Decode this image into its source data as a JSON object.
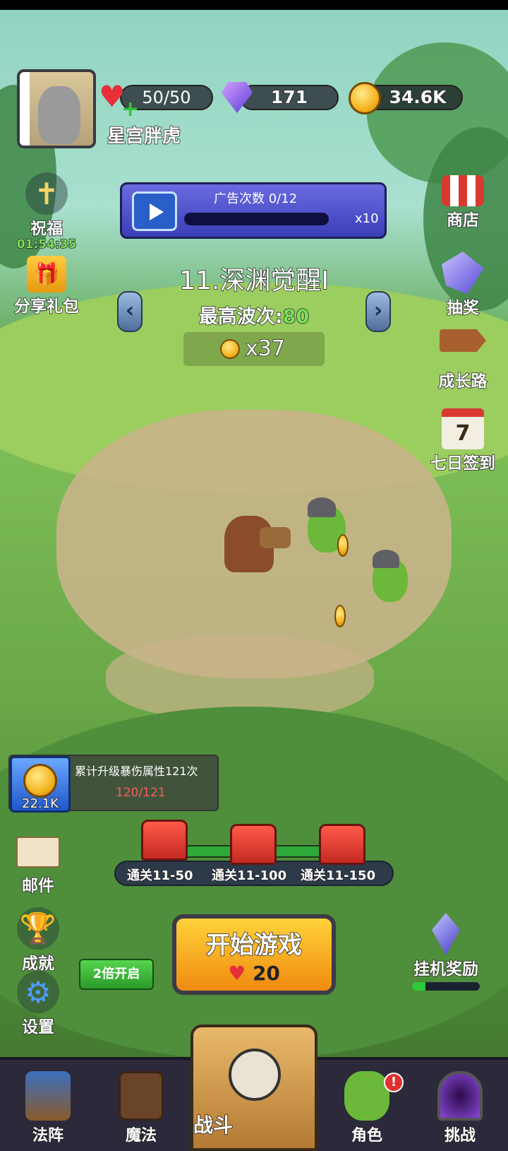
{
  "player": {
    "name": "星宫胖虎"
  },
  "resources": {
    "energy": "50/50",
    "gems": "171",
    "coins": "34.6K"
  },
  "ad": {
    "title": "广告次数 0/12",
    "progress": 0,
    "multiplier": "x10"
  },
  "left_menu": [
    {
      "label": "祝福",
      "timer": "01:54:35",
      "icon": "cross-icon"
    },
    {
      "label": "分享礼包",
      "icon": "gift-icon"
    }
  ],
  "right_menu": [
    {
      "label": "商店",
      "icon": "shop-icon"
    },
    {
      "label": "抽奖",
      "icon": "crystal-icon"
    },
    {
      "label": "成长路",
      "icon": "signpost-icon"
    },
    {
      "label": "七日签到",
      "icon": "calendar-icon",
      "day": "7"
    }
  ],
  "level": {
    "title": "11.深渊觉醒I",
    "wave_label": "最高波次:",
    "wave_value": "80",
    "cost": "x37"
  },
  "quest": {
    "amount": "22.1K",
    "text": "累计升级暴伤属性121次",
    "progress": "120/121"
  },
  "chests": [
    {
      "label": "通关11-50"
    },
    {
      "label": "通关11-100"
    },
    {
      "label": "通关11-150"
    }
  ],
  "side_bottom": [
    {
      "label": "邮件",
      "icon": "mail-icon"
    },
    {
      "label": "成就",
      "icon": "trophy-icon"
    },
    {
      "label": "设置",
      "icon": "gear-icon"
    }
  ],
  "double_label": "2倍开启",
  "start": {
    "label": "开始游戏",
    "cost": "20"
  },
  "idle_reward": {
    "label": "挂机奖励",
    "progress": 0.2
  },
  "nav": [
    {
      "label": "法阵",
      "icon": "tower-icon"
    },
    {
      "label": "魔法",
      "icon": "spellbook-icon"
    },
    {
      "label": "战斗",
      "icon": "skull-icon"
    },
    {
      "label": "角色",
      "icon": "orc-icon"
    },
    {
      "label": "挑战",
      "icon": "portal-icon"
    }
  ],
  "colors": {
    "accent_green": "#7be05a",
    "heart_red": "#e6303a",
    "coin_gold": "#f4b420"
  }
}
